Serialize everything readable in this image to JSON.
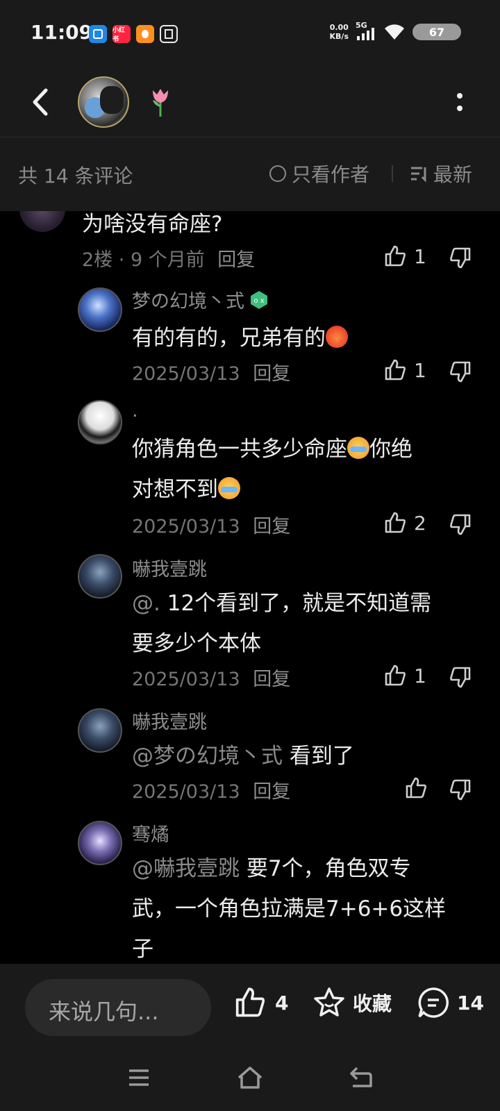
{
  "status_bar": {
    "time": "11:09",
    "net_speed_value": "0.00",
    "net_speed_unit": "KB/s",
    "signal_type": "5G",
    "battery": "67",
    "app_icons": [
      {
        "name": "cut-app-icon",
        "color": "#1e88e5",
        "label": ""
      },
      {
        "name": "xiaohongshu-app-icon",
        "color": "#ff2442",
        "label": "小红书"
      },
      {
        "name": "qq-app-icon",
        "color": "#ff8f1f",
        "label": ""
      },
      {
        "name": "notes-app-icon",
        "color": "#eaeaea",
        "label": ""
      }
    ]
  },
  "header": {
    "emoji": "tulip"
  },
  "filter_bar": {
    "count_label": "共 14 条评论",
    "author_only_label": "只看作者",
    "sort_label": "最新"
  },
  "comments": {
    "top": {
      "text": "为啥没有命座?",
      "floor": "2楼",
      "time": "9 个月前",
      "reply_label": "回复",
      "likes": "1"
    },
    "replies": [
      {
        "author": "梦の幻境丶式",
        "text": "有的有的，兄弟有的",
        "emoji": "angry",
        "date": "2025/03/13",
        "reply_label": "回复",
        "likes": "1"
      },
      {
        "author": ".",
        "text_line1": "你猜角色一共多少命座",
        "text_line1b": "你绝",
        "text_line2": "对想不到",
        "date": "2025/03/13",
        "reply_label": "回复",
        "likes": "2"
      },
      {
        "author": "嚇我壹跳",
        "mention": "@.",
        "text_line1": "12个看到了，就是不知道需",
        "text_line2": "要多少个本体",
        "date": "2025/03/13",
        "reply_label": "回复",
        "likes": "1"
      },
      {
        "author": "嚇我壹跳",
        "mention": "@梦の幻境丶式",
        "text": "看到了",
        "date": "2025/03/13",
        "reply_label": "回复",
        "likes": ""
      },
      {
        "author": "骞燏",
        "mention": "@嚇我壹跳",
        "text_line1": "要7个，角色双专",
        "text_line2": "武，一个角色拉满是7+6+6这样",
        "text_line3": "子"
      }
    ]
  },
  "bottom_bar": {
    "input_placeholder": "来说几句...",
    "like_count": "4",
    "favorite_label": "收藏",
    "comment_count": "14"
  }
}
